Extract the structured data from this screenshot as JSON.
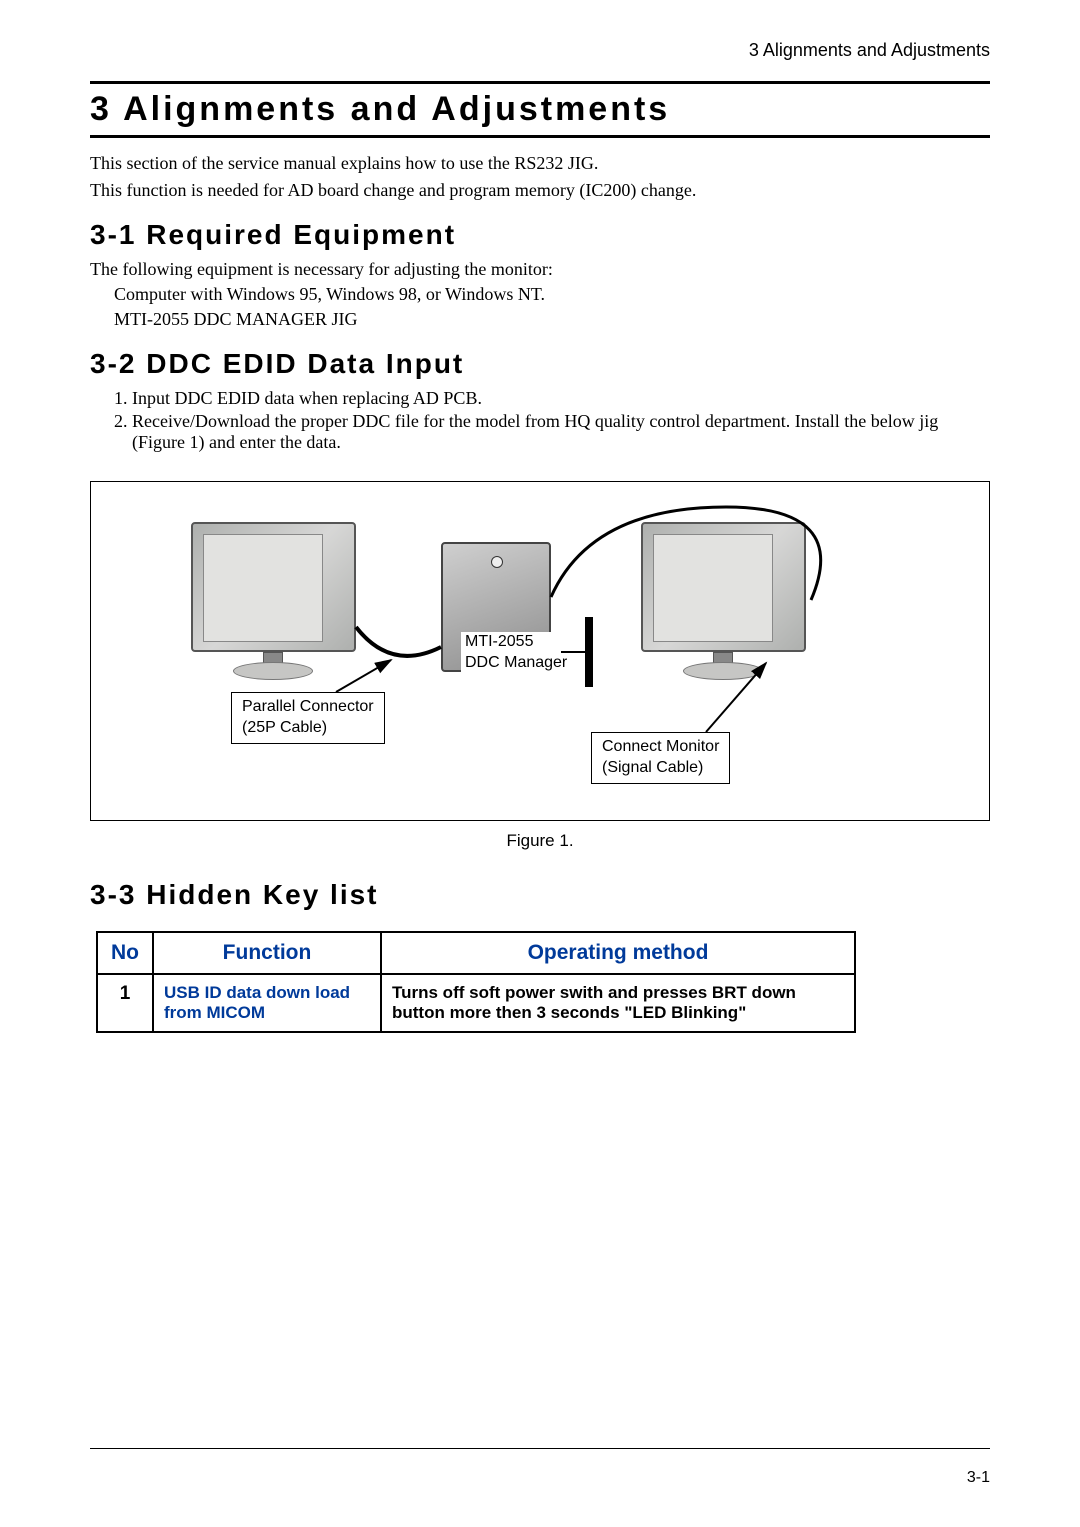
{
  "header": {
    "running_head": "3 Alignments and Adjustments"
  },
  "title": "3 Alignments and Adjustments",
  "intro": {
    "line1": "This section of the service manual explains how to use the RS232 JIG.",
    "line2": "This function is needed for AD board change and program memory (IC200) change."
  },
  "sections": {
    "s31": {
      "heading": "3-1 Required Equipment",
      "lead": "The following equipment is necessary for adjusting the monitor:",
      "item1": "Computer with Windows 95, Windows 98, or Windows NT.",
      "item2": "MTI-2055 DDC MANAGER JIG"
    },
    "s32": {
      "heading": "3-2 DDC EDID Data Input",
      "steps": [
        "Input DDC EDID data when replacing AD PCB.",
        "Receive/Download the proper DDC file for the model from HQ quality control department. Install the below jig (Figure 1) and enter the data."
      ]
    },
    "figure": {
      "caption": "Figure 1.",
      "label_parallel_l1": "Parallel Connector",
      "label_parallel_l2": "(25P Cable)",
      "label_ddc_l1": "MTI-2055",
      "label_ddc_l2": "DDC Manager",
      "label_signal_l1": "Connect Monitor",
      "label_signal_l2": "(Signal Cable)"
    },
    "s33": {
      "heading": "3-3 Hidden Key list"
    }
  },
  "table": {
    "headers": {
      "no": "No",
      "function": "Function",
      "method": "Operating method"
    },
    "rows": [
      {
        "no": "1",
        "function": "USB ID data down load from MICOM",
        "method": "Turns off soft power swith and presses BRT down button more then 3 seconds \"LED Blinking\""
      }
    ]
  },
  "footer": {
    "page_num": "3-1"
  }
}
